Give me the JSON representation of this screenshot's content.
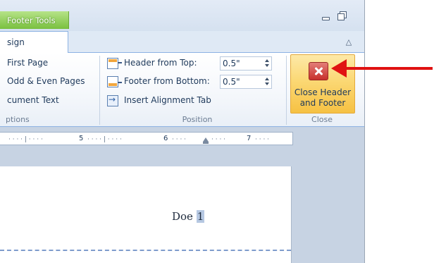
{
  "contextual_tab": {
    "title": "Footer Tools"
  },
  "tabs": {
    "design": "sign"
  },
  "options_group": {
    "items": [
      "First Page",
      "Odd & Even Pages",
      "cument Text"
    ],
    "label": "ptions"
  },
  "position_group": {
    "header_from_top": {
      "label": "Header from Top:",
      "value": "0.5\""
    },
    "footer_from_bottom": {
      "label": "Footer from Bottom:",
      "value": "0.5\""
    },
    "insert_alignment_tab": "Insert Alignment Tab",
    "label": "Position"
  },
  "close_group": {
    "button_line1": "Close Header",
    "button_line2": "and Footer",
    "label": "Close"
  },
  "ruler": {
    "numbers": [
      "5",
      "6",
      "7"
    ]
  },
  "document": {
    "header_text_plain": "Doe ",
    "header_text_selected": "1"
  },
  "colors": {
    "contextual_tab": "#79c03f",
    "close_button": "#fbd874",
    "annotation_arrow": "#e01212",
    "selection": "#b6c8e2"
  }
}
